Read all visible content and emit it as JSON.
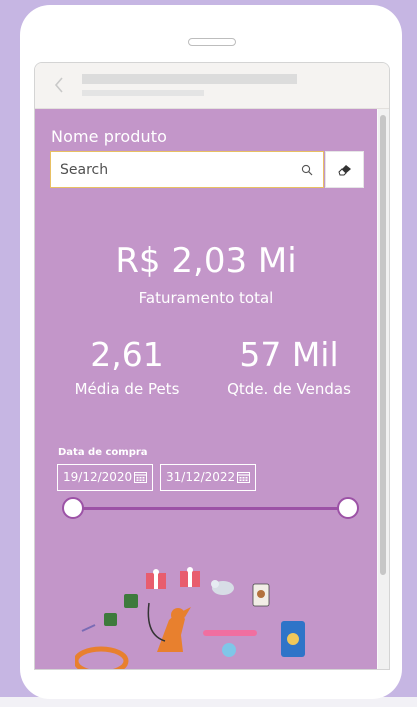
{
  "slicer": {
    "title": "Nome produto",
    "search_placeholder": "Search"
  },
  "kpis": {
    "revenue": {
      "value": "R$ 2,03 Mi",
      "label": "Faturamento total"
    },
    "pets": {
      "value": "2,61",
      "label": "Média de Pets"
    },
    "sales": {
      "value": "57 Mil",
      "label": "Qtde. de Vendas"
    }
  },
  "date_filter": {
    "title": "Data de compra",
    "start": "19/12/2020",
    "end": "31/12/2022"
  },
  "colors": {
    "report_background": "#c396c9",
    "slider_accent": "#9c52a6",
    "search_border": "#e8c063"
  },
  "icons": [
    "back-chevron-icon",
    "search-icon",
    "eraser-icon",
    "calendar-icon",
    "pet-products-icon"
  ]
}
